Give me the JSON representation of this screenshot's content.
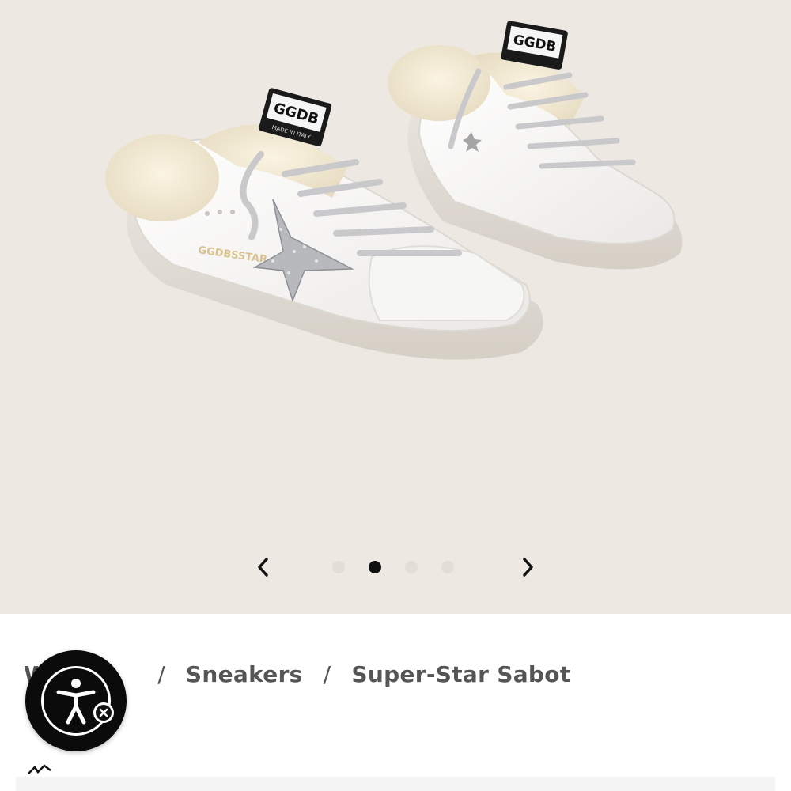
{
  "gallery": {
    "product_image_alt": "Super-Star Sabot",
    "slides": [
      {
        "label": "slide-1",
        "active": false
      },
      {
        "label": "slide-2",
        "active": true
      },
      {
        "label": "slide-3",
        "active": false
      },
      {
        "label": "slide-4",
        "active": false
      }
    ],
    "prev_icon": "chevron-left-icon",
    "next_icon": "chevron-right-icon",
    "tag_text": "GGDB",
    "tag_subtext": "MADE IN ITALY",
    "side_print": "GGDBSSTAR"
  },
  "breadcrumb": {
    "items": [
      "W",
      "Sneakers",
      "Super-Star Sabot"
    ],
    "separator": "/"
  },
  "accessibility": {
    "icon": "accessibility-person-icon",
    "close_icon": "close-icon"
  },
  "colors": {
    "background": "#ede8e1",
    "dot_active": "#111111",
    "dot_inactive": "#e2ddd7",
    "breadcrumb_text": "#555555"
  }
}
